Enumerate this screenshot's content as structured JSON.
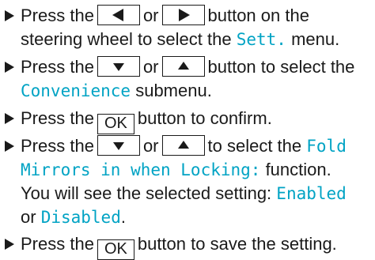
{
  "colors": {
    "text": "#1a1a1a",
    "display_text": "#00a3c4"
  },
  "step1": {
    "t1": "Press the",
    "or": "or",
    "t2": "button on the",
    "t3": "steering wheel to select the",
    "menu": "Sett.",
    "t4": "menu.",
    "icons": [
      "left-arrow-key",
      "right-arrow-key"
    ]
  },
  "step2": {
    "t1": "Press the",
    "or": "or",
    "t2": "button to select the",
    "submenu": "Convenience",
    "t3": "submenu.",
    "icons": [
      "down-arrow-key",
      "up-arrow-key"
    ]
  },
  "step3": {
    "t1": "Press the",
    "ok": "OK",
    "t2": "button to confirm."
  },
  "step4": {
    "t1": "Press the",
    "or": "or",
    "t2": "to select the",
    "function_a": "Fold",
    "function_b": "Mirrors in when Locking:",
    "t3": "function.",
    "t4": "You will see the selected setting:",
    "enabled": "Enabled",
    "t5": "or",
    "disabled": "Disabled",
    "period": ".",
    "icons": [
      "down-arrow-key",
      "up-arrow-key"
    ]
  },
  "step5": {
    "t1": "Press the",
    "ok": "OK",
    "t2": "button to save the setting."
  }
}
